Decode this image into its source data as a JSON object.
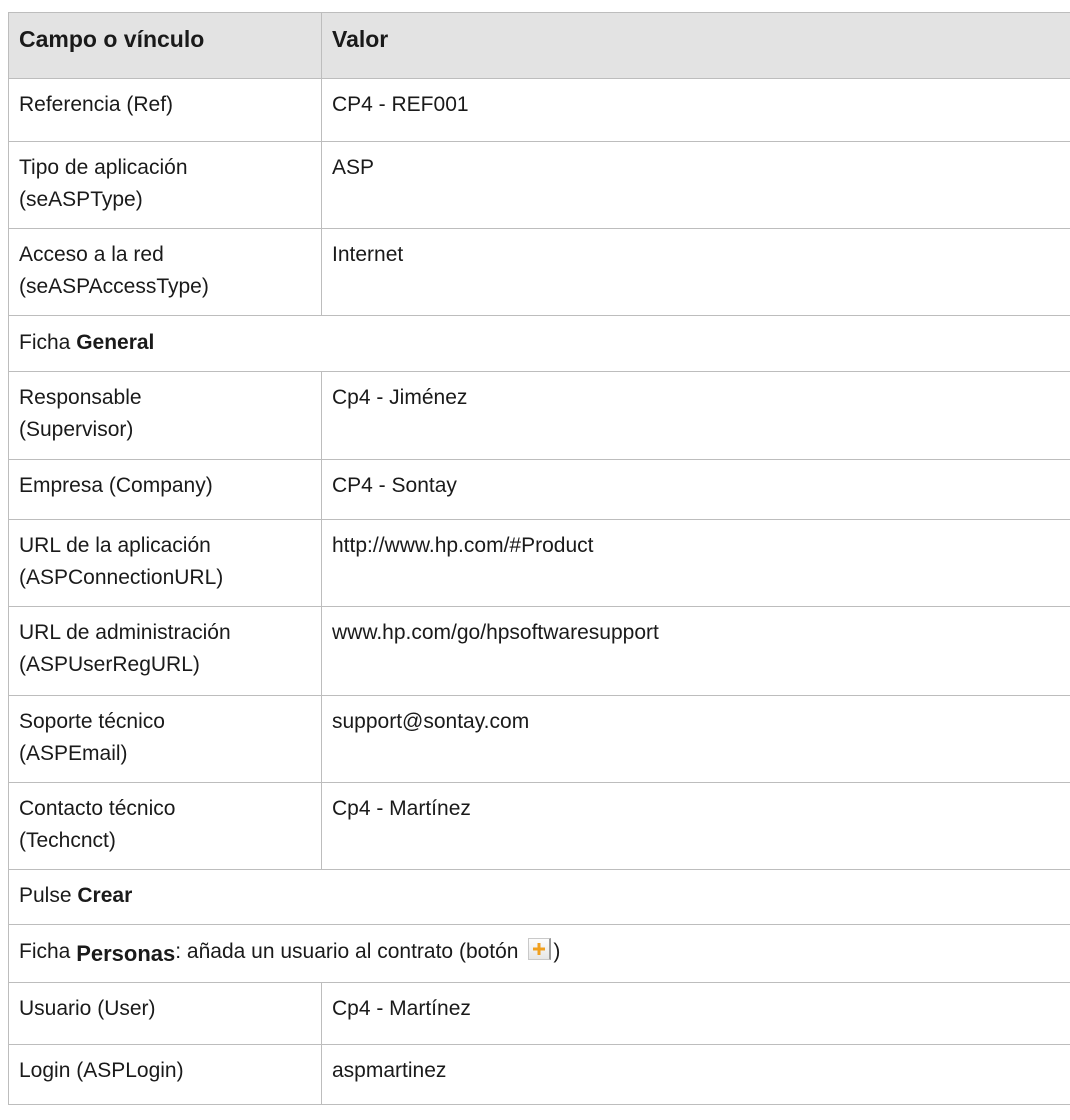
{
  "header": {
    "field_label": "Campo o vínculo",
    "value_label": "Valor"
  },
  "rows": [
    {
      "field_line1": "Referencia (Ref)",
      "value": "CP4 - REF001"
    },
    {
      "field_line1": "Tipo de aplicación",
      "field_line2": "(seASPType)",
      "value": "ASP"
    },
    {
      "field_line1": "Acceso a la red",
      "field_line2": "(seASPAccessType)",
      "value": "Internet"
    },
    {
      "section_prefix": "Ficha ",
      "section_bold": "General"
    },
    {
      "field_line1": "Responsable",
      "field_line2": "(Supervisor)",
      "value": "Cp4 - Jiménez"
    },
    {
      "field_line1": "Empresa (Company)",
      "value": "CP4 - Sontay"
    },
    {
      "field_line1": "URL de la aplicación",
      "field_line2": "(ASPConnectionURL)",
      "value": "http://www.hp.com/#Product"
    },
    {
      "field_line1": "URL de administración",
      "field_line2": "(ASPUserRegURL)",
      "value": "www.hp.com/go/hpsoftwaresupport"
    },
    {
      "field_line1": "Soporte técnico",
      "field_line2": "(ASPEmail)",
      "value": "support@sontay.com"
    },
    {
      "field_line1": "Contacto técnico",
      "field_line2": "(Techcnct)",
      "value": "Cp4 - Martínez"
    },
    {
      "section_prefix": "Pulse ",
      "section_bold": "Crear"
    },
    {
      "section_prefix": "Ficha ",
      "section_bold": "Personas",
      "section_suffix": ": añada un usuario al contrato (botón ",
      "section_end": ")",
      "icon": "add-plus-icon"
    },
    {
      "field_line1": "Usuario (User)",
      "value": "Cp4 - Martínez"
    },
    {
      "field_line1": "Login (ASPLogin)",
      "value": "aspmartinez"
    }
  ],
  "colors": {
    "header_bg": "#e3e3e3",
    "border": "#bdbdbd",
    "plus_icon": "#f0a020"
  }
}
